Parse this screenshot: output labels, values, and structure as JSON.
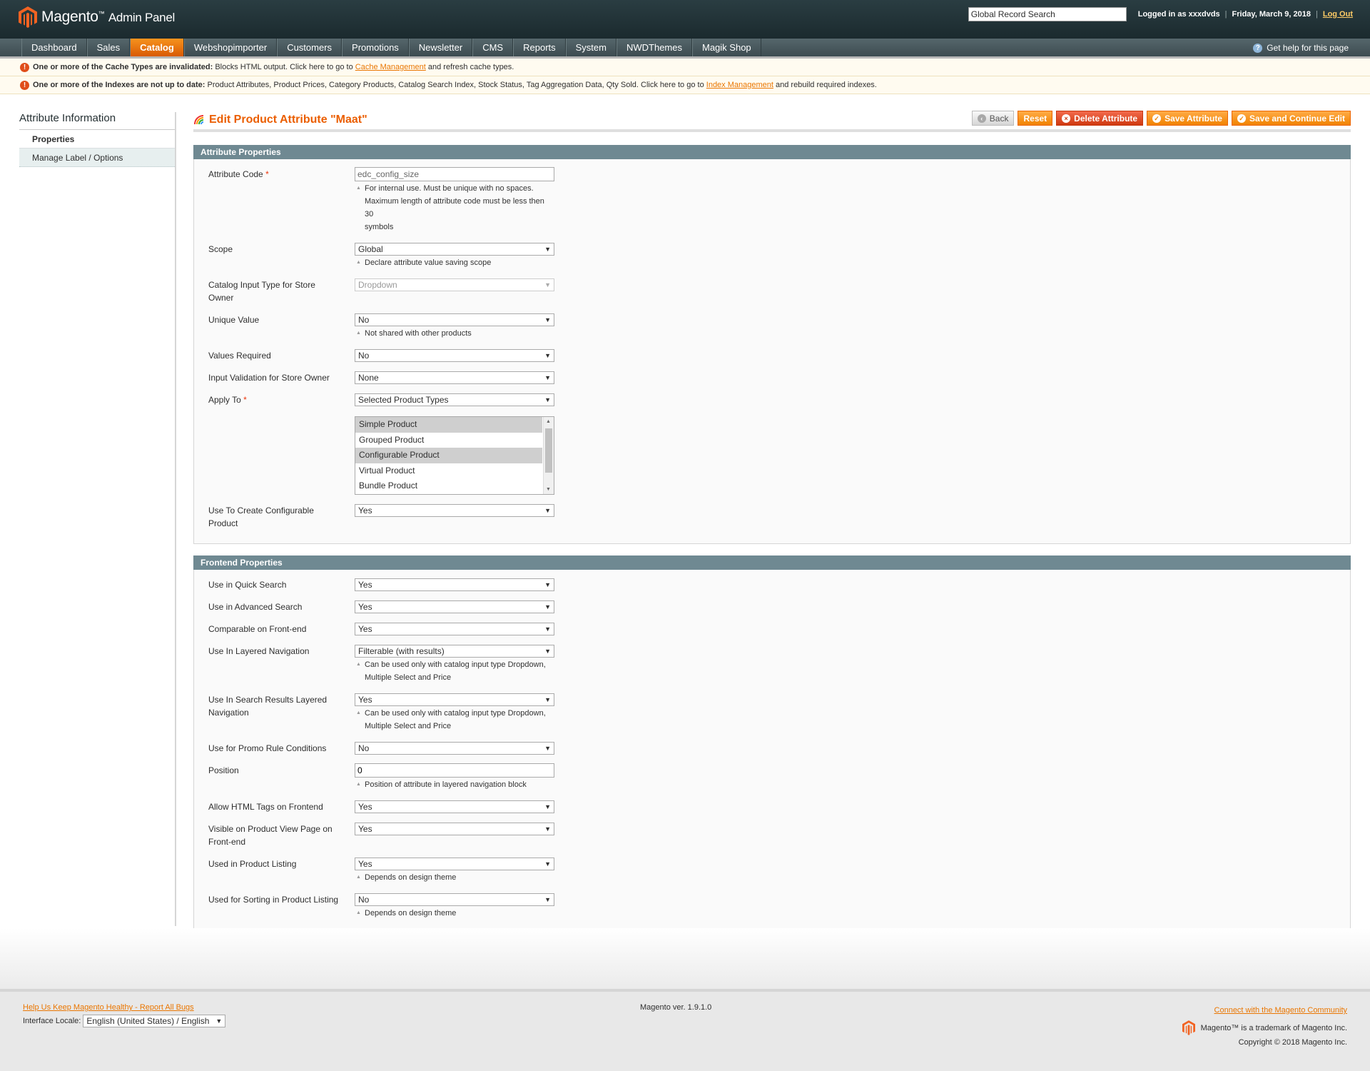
{
  "header": {
    "logo_brand": "Magento",
    "logo_tm": "™",
    "logo_sub": "Admin Panel",
    "search_value": "Global Record Search",
    "logged_in": "Logged in as xxxdvds",
    "date": "Friday, March 9, 2018",
    "logout": "Log Out",
    "separator": "|"
  },
  "nav": {
    "items": [
      "Dashboard",
      "Sales",
      "Catalog",
      "Webshopimporter",
      "Customers",
      "Promotions",
      "Newsletter",
      "CMS",
      "Reports",
      "System",
      "NWDThemes",
      "Magik Shop"
    ],
    "active": "Catalog",
    "help": "Get help for this page"
  },
  "notices": [
    {
      "bold": "One or more of the Cache Types are invalidated:",
      "text": " Blocks HTML output. Click here to go to ",
      "link": "Cache Management",
      "after": " and refresh cache types."
    },
    {
      "bold": "One or more of the Indexes are not up to date:",
      "text": " Product Attributes, Product Prices, Category Products, Catalog Search Index, Stock Status, Tag Aggregation Data, Qty Sold. Click here to go to ",
      "link": "Index Management",
      "after": " and rebuild required indexes."
    }
  ],
  "sidebar": {
    "title": "Attribute Information",
    "tabs": [
      "Properties",
      "Manage Label / Options"
    ]
  },
  "page": {
    "title": "Edit Product Attribute \"Maat\"",
    "buttons": {
      "back": "Back",
      "reset": "Reset",
      "delete": "Delete Attribute",
      "save": "Save Attribute",
      "save_continue": "Save and Continue Edit"
    }
  },
  "attribute_properties": {
    "title": "Attribute Properties",
    "attribute_code": {
      "label": "Attribute Code",
      "value": "edc_config_size",
      "note1": "For internal use. Must be unique with no spaces.",
      "note2": "Maximum length of attribute code must be less then 30",
      "note3": "symbols"
    },
    "scope": {
      "label": "Scope",
      "value": "Global",
      "note": "Declare attribute value saving scope"
    },
    "input_type": {
      "label1": "Catalog Input Type for Store",
      "label2": "Owner",
      "value": "Dropdown"
    },
    "unique": {
      "label": "Unique Value",
      "value": "No",
      "note": "Not shared with other products"
    },
    "required": {
      "label": "Values Required",
      "value": "No"
    },
    "validation": {
      "label": "Input Validation for Store Owner",
      "value": "None"
    },
    "apply_to": {
      "label": "Apply To",
      "value": "Selected Product Types"
    },
    "product_types": [
      {
        "label": "Simple Product",
        "selected": true
      },
      {
        "label": "Grouped Product",
        "selected": false
      },
      {
        "label": "Configurable Product",
        "selected": true
      },
      {
        "label": "Virtual Product",
        "selected": false
      },
      {
        "label": "Bundle Product",
        "selected": false
      }
    ],
    "configurable": {
      "label1": "Use To Create Configurable",
      "label2": "Product",
      "value": "Yes"
    }
  },
  "frontend_properties": {
    "title": "Frontend Properties",
    "quick_search": {
      "label": "Use in Quick Search",
      "value": "Yes"
    },
    "advanced_search": {
      "label": "Use in Advanced Search",
      "value": "Yes"
    },
    "comparable": {
      "label": "Comparable on Front-end",
      "value": "Yes"
    },
    "layered_nav": {
      "label": "Use In Layered Navigation",
      "value": "Filterable (with results)",
      "note1": "Can be used only with catalog input type Dropdown,",
      "note2": "Multiple Select and Price"
    },
    "search_layered": {
      "label1": "Use In Search Results Layered",
      "label2": "Navigation",
      "value": "Yes",
      "note1": "Can be used only with catalog input type Dropdown,",
      "note2": "Multiple Select and Price"
    },
    "promo": {
      "label": "Use for Promo Rule Conditions",
      "value": "No"
    },
    "position": {
      "label": "Position",
      "value": "0",
      "note": "Position of attribute in layered navigation block"
    },
    "html_tags": {
      "label": "Allow HTML Tags on Frontend",
      "value": "Yes"
    },
    "visible": {
      "label1": "Visible on Product View Page on",
      "label2": "Front-end",
      "value": "Yes"
    },
    "listing": {
      "label": "Used in Product Listing",
      "value": "Yes",
      "note": "Depends on design theme"
    },
    "sorting": {
      "label": "Used for Sorting in Product Listing",
      "value": "No",
      "note": "Depends on design theme"
    }
  },
  "footer": {
    "bugs_link": "Help Us Keep Magento Healthy - Report All Bugs",
    "locale_label": "Interface Locale:",
    "locale_value": "English (United States) / English",
    "version": "Magento ver. 1.9.1.0",
    "community_link": "Connect with the Magento Community",
    "trademark": "Magento™ is a trademark of Magento Inc.",
    "copyright": "Copyright © 2018 Magento Inc."
  },
  "icons": {
    "logo": "magento-logo-icon",
    "notice": "error-icon",
    "help": "help-icon",
    "dropdown": "chevron-down-icon"
  },
  "colors": {
    "accent": "#eb5e00",
    "nav_active": "#f18200",
    "fieldset_header": "#6f8992",
    "notice_bg": "#fffbf0",
    "link": "#ea7601"
  }
}
